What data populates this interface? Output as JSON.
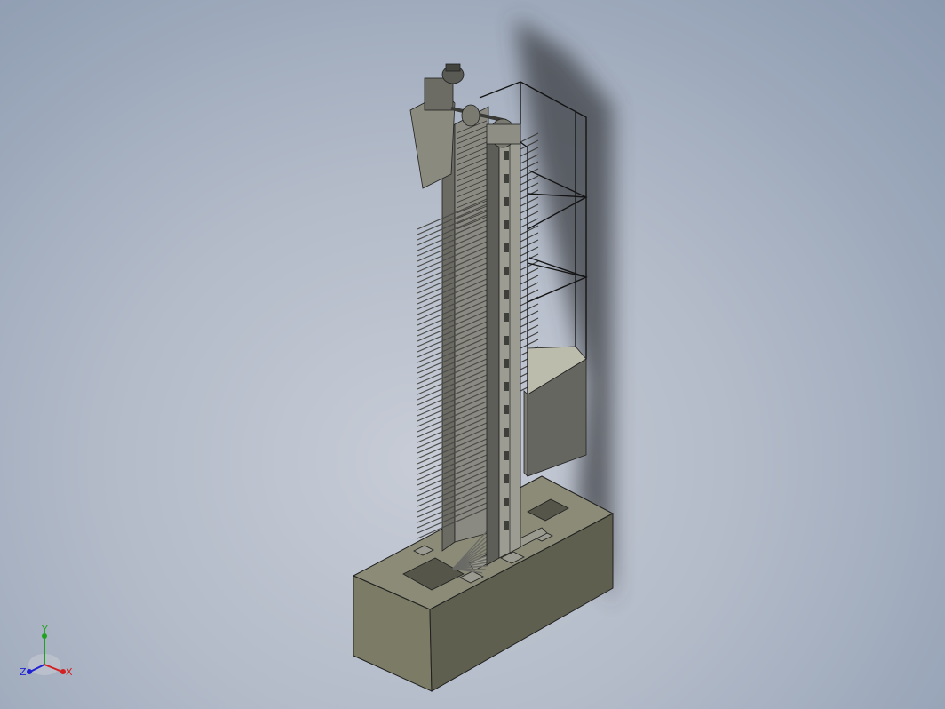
{
  "viewport": {
    "background_top": "#8c9ab0",
    "background_center": "#c7ccd6"
  },
  "model": {
    "colors": {
      "concrete_top": "#8b8b78",
      "concrete_front": "#74745f",
      "concrete_side": "#5a5a4a",
      "frame": "#8d8d84",
      "frame_dark": "#4e4e48",
      "tines": "#5c5c58",
      "edge": "#202020"
    }
  },
  "triad": {
    "labels": {
      "x": "X",
      "y": "Y",
      "z": "Z"
    },
    "colors": {
      "x": "#d42020",
      "y": "#1fa31f",
      "z": "#2020d4"
    }
  }
}
